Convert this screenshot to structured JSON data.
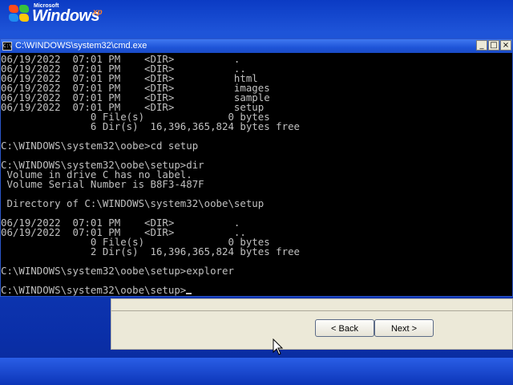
{
  "branding": {
    "microsoft": "Microsoft",
    "windows": "Windows",
    "xp": "xp"
  },
  "cmd": {
    "title": "C:\\WINDOWS\\system32\\cmd.exe",
    "icon_label": "C:\\",
    "lines": [
      "06/19/2022  07:01 PM    <DIR>          .",
      "06/19/2022  07:01 PM    <DIR>          ..",
      "06/19/2022  07:01 PM    <DIR>          html",
      "06/19/2022  07:01 PM    <DIR>          images",
      "06/19/2022  07:01 PM    <DIR>          sample",
      "06/19/2022  07:01 PM    <DIR>          setup",
      "               0 File(s)              0 bytes",
      "               6 Dir(s)  16,396,365,824 bytes free",
      "",
      "C:\\WINDOWS\\system32\\oobe>cd setup",
      "",
      "C:\\WINDOWS\\system32\\oobe\\setup>dir",
      " Volume in drive C has no label.",
      " Volume Serial Number is B8F3-487F",
      "",
      " Directory of C:\\WINDOWS\\system32\\oobe\\setup",
      "",
      "06/19/2022  07:01 PM    <DIR>          .",
      "06/19/2022  07:01 PM    <DIR>          ..",
      "               0 File(s)              0 bytes",
      "               2 Dir(s)  16,396,365,824 bytes free",
      "",
      "C:\\WINDOWS\\system32\\oobe\\setup>explorer",
      "",
      "C:\\WINDOWS\\system32\\oobe\\setup>"
    ]
  },
  "setup": {
    "back_label": "< Back",
    "next_label": "Next >"
  },
  "colors": {
    "console_text": "#c0c0c0",
    "console_bg": "#000000",
    "titlebar": "#1e54d8",
    "desktop": "#0a2fa8"
  }
}
